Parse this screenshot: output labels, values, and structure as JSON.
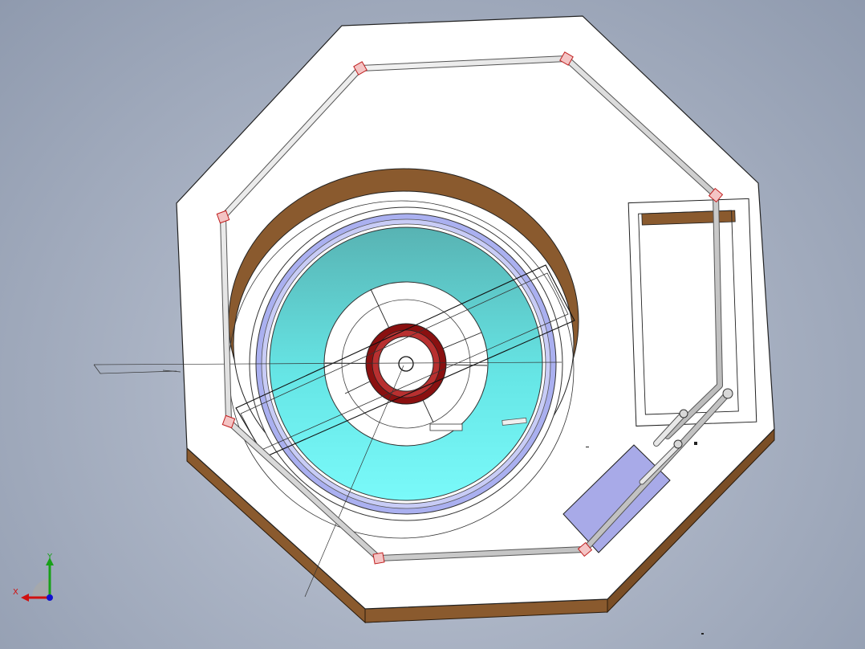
{
  "view": {
    "background_top": "#c3cad8",
    "background_bottom": "#8f9aae"
  },
  "model": {
    "plate_color": "#ffffff",
    "plate_edge_color": "#8a5a2e",
    "ring_color": "#c8a070",
    "flange_color": "#aab0f0",
    "bowl_color": "#5fd0d0",
    "hub_color": "#8a1010",
    "pipe_color": "#dcdcdc",
    "fitting_color": "#e05050",
    "box_color": "#a8aae8"
  },
  "triad": {
    "x_label": "X",
    "y_label": "Y",
    "x_color": "#d01010",
    "y_color": "#18a018",
    "z_color": "#1010d0"
  }
}
